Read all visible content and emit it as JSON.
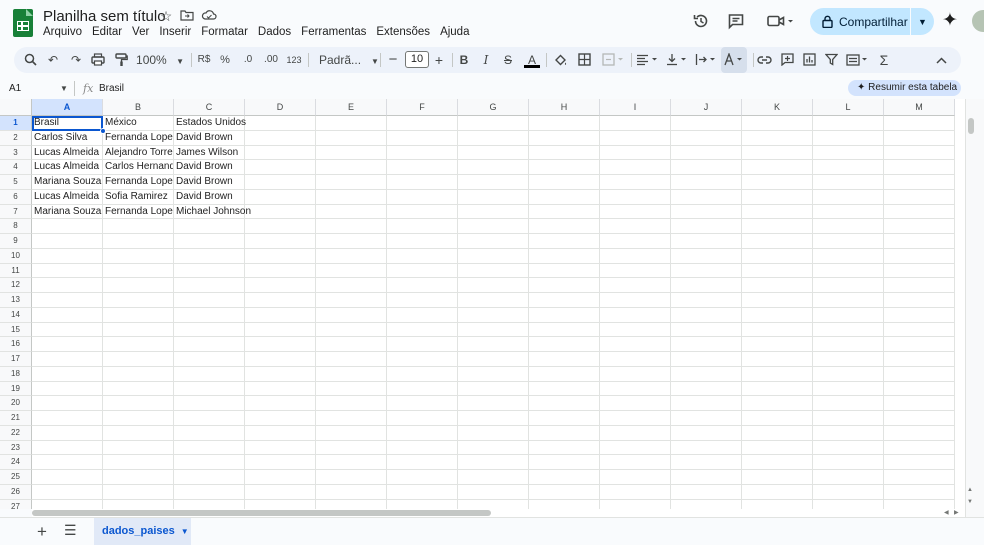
{
  "header": {
    "title": "Planilha sem título",
    "menu": [
      "Arquivo",
      "Editar",
      "Ver",
      "Inserir",
      "Formatar",
      "Dados",
      "Ferramentas",
      "Extensões",
      "Ajuda"
    ],
    "share_label": "Compartilhar",
    "icons": [
      "star-icon",
      "move-folder-icon",
      "cloud-status-icon",
      "history-icon",
      "comments-icon",
      "video-call-icon",
      "gemini-icon"
    ]
  },
  "toolbar": {
    "zoom": "100%",
    "currency": "R$",
    "percent": "%",
    "dec_decrease": ".0",
    "dec_increase": ".00",
    "number_format": "123",
    "font_family": "Padrã...",
    "font_size": "10"
  },
  "formula_bar": {
    "name_box": "A1",
    "fx_symbol": "fx",
    "value": "Brasil",
    "summary_label": "Resumir esta tabela"
  },
  "grid": {
    "columns": [
      "A",
      "B",
      "C",
      "D",
      "E",
      "F",
      "G",
      "H",
      "I",
      "J",
      "K",
      "L",
      "M"
    ],
    "rows": [
      "1",
      "2",
      "3",
      "4",
      "5",
      "6",
      "7",
      "8",
      "9",
      "10",
      "11",
      "12",
      "13",
      "14",
      "15",
      "16",
      "17",
      "18",
      "19",
      "20",
      "21",
      "22",
      "23",
      "24",
      "25",
      "26",
      "27"
    ],
    "cells": [
      [
        "Brasil",
        "México",
        "Estados Unidos"
      ],
      [
        "Carlos Silva",
        "Fernanda Lopez",
        "David Brown"
      ],
      [
        "Lucas Almeida",
        "Alejandro Torres",
        "James Wilson"
      ],
      [
        "Lucas Almeida",
        "Carlos Hernandez",
        "David Brown"
      ],
      [
        "Mariana Souza",
        "Fernanda Lopez",
        "David Brown"
      ],
      [
        "Lucas Almeida",
        "Sofia Ramirez",
        "David Brown"
      ],
      [
        "Mariana Souza",
        "Fernanda Lopez",
        "Michael Johnson"
      ]
    ],
    "selected_cell": "A1"
  },
  "sheets": {
    "tabs": [
      "dados_paises"
    ],
    "active": "dados_paises"
  },
  "colors": {
    "accent": "#0b57d0",
    "share_bg": "#c2e7ff",
    "toolbar_bg": "#edf2fa",
    "logo_green": "#188038"
  }
}
